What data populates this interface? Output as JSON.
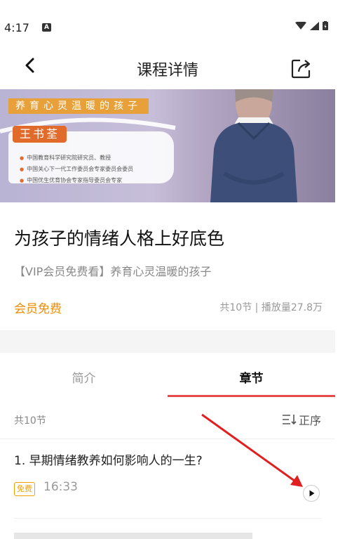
{
  "status_bar": {
    "time": "4:17"
  },
  "header": {
    "title": "课程详情"
  },
  "banner": {
    "series_title": "养育心灵温暖的孩子",
    "lecturer": "王书荃",
    "credentials": [
      "中国教育科学研究院研究员、教授",
      "中国关心下一代工作委员会专家委员会委员",
      "中国优生优育协会专家指导委员会专家"
    ]
  },
  "course": {
    "title": "为孩子的情绪人格上好底色",
    "subtitle": "【VIP会员免费看】养育心灵温暖的孩子",
    "price_label": "会员免费",
    "stats": "共10节 | 播放量27.8万"
  },
  "tabs": [
    {
      "label": "简介",
      "active": false
    },
    {
      "label": "章节",
      "active": true
    }
  ],
  "chapters": {
    "count_label": "共10节",
    "order_label": "正序",
    "items": [
      {
        "title": "1. 早期情绪教养如何影响人的一生?",
        "tag": "免费",
        "duration": "16:33"
      }
    ]
  },
  "colors": {
    "accent_orange": "#f08c00",
    "tab_underline": "#e84a4a",
    "annotation_arrow": "#e02020"
  }
}
